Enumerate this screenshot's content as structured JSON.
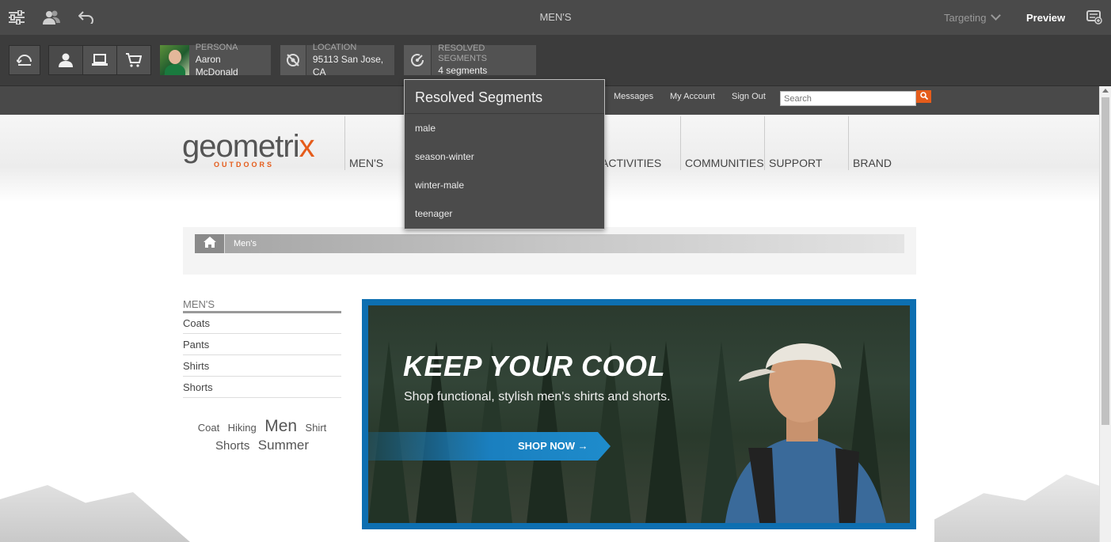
{
  "topbar": {
    "title": "MEN'S",
    "targeting_label": "Targeting",
    "preview_label": "Preview"
  },
  "context": {
    "persona": {
      "label": "PERSONA",
      "value": "Aaron McDonald"
    },
    "location": {
      "label": "LOCATION",
      "value": "95113 San Jose, CA"
    },
    "segments": {
      "label": "RESOLVED SEGMENTS",
      "value": "4 segments"
    }
  },
  "popover": {
    "title": "Resolved Segments",
    "items": [
      "male",
      "season-winter",
      "winter-male",
      "teenager"
    ]
  },
  "site": {
    "links": [
      "Messages",
      "My Account",
      "Sign Out"
    ],
    "search_placeholder": "Search",
    "logo_word_a": "geometri",
    "logo_word_b": "x",
    "logo_sub": "OUTDOORS",
    "nav": [
      "MEN'S",
      "ACTIVITIES",
      "COMMUNITIES",
      "SUPPORT",
      "BRAND"
    ],
    "breadcrumb_current": "Men's",
    "left_nav_title": "MEN'S",
    "left_nav_items": [
      "Coats",
      "Pants",
      "Shirts",
      "Shorts"
    ],
    "tags": [
      "Coat",
      "Hiking",
      "Men",
      "Shirt",
      "Shorts",
      "Summer"
    ]
  },
  "hero": {
    "headline": "KEEP YOUR COOL",
    "subline": "Shop functional, stylish men's shirts and shorts.",
    "cta": "SHOP NOW →"
  },
  "colors": {
    "accent_orange": "#e55c1b",
    "hero_border_blue": "#0d6fb1",
    "editor_dark": "#4a4a4a"
  }
}
